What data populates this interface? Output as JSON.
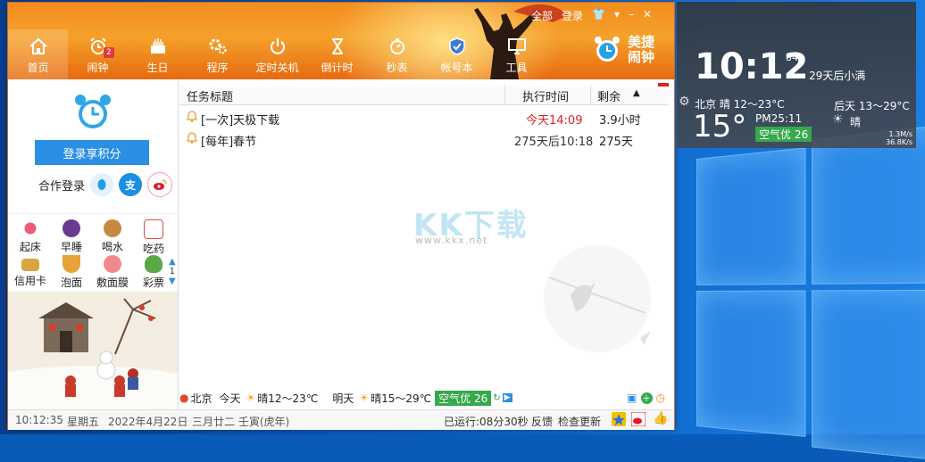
{
  "window_controls": {
    "all": "全部",
    "login": "登录"
  },
  "nav": [
    {
      "label": "首页",
      "icon": "home-icon",
      "active": true
    },
    {
      "label": "闹钟",
      "icon": "alarm-icon",
      "badge": "2"
    },
    {
      "label": "生日",
      "icon": "cake-icon"
    },
    {
      "label": "程序",
      "icon": "gears-icon"
    },
    {
      "label": "定时关机",
      "icon": "power-icon"
    },
    {
      "label": "倒计时",
      "icon": "hourglass-icon"
    },
    {
      "label": "秒表",
      "icon": "stopwatch-icon"
    },
    {
      "label": "帐号本",
      "icon": "shield-icon"
    },
    {
      "label": "工具",
      "icon": "monitor-icon"
    }
  ],
  "brand": {
    "line1": "美捷",
    "line2": "闹钟"
  },
  "sidebar": {
    "login_button": "登录享积分",
    "coop_label": "合作登录",
    "quick_items": [
      {
        "label": "起床",
        "color": "#f05a7a"
      },
      {
        "label": "早睡",
        "color": "#6a3a8f"
      },
      {
        "label": "喝水",
        "color": "#c58a3e"
      },
      {
        "label": "吃药",
        "color": "#e04848"
      },
      {
        "label": "信用卡",
        "color": "#d9a441"
      },
      {
        "label": "泡面",
        "color": "#e7a33a"
      },
      {
        "label": "敷面膜",
        "color": "#f08a8a"
      },
      {
        "label": "彩票",
        "color": "#5aa848"
      }
    ],
    "page_number": "1"
  },
  "task_table": {
    "columns": {
      "title": "任务标题",
      "time": "执行时间",
      "remaining": "剩余"
    },
    "rows": [
      {
        "title": "[一次]天极下载",
        "time": "今天14:09",
        "remaining": "3.9小时",
        "time_color": "#e02020"
      },
      {
        "title": "[每年]春节",
        "time": "275天后10:18",
        "remaining": "275天",
        "time_color": "#333333"
      }
    ]
  },
  "watermark": {
    "logo": "KK下载",
    "url": "www.kkx.net"
  },
  "weather_bar": {
    "city": "北京",
    "today_label": "今天",
    "today": "晴12～23℃",
    "tomorrow_label": "明天",
    "tomorrow": "晴15～29℃",
    "air": "空气优 26"
  },
  "status": {
    "clock": "10:12:35",
    "weekday": "星期五",
    "date": "2022年4月22日",
    "lunar": "三月廿二 壬寅(虎年)",
    "uptime": "已运行:08分30秒",
    "feedback": "反馈",
    "check_update": "检查更新"
  },
  "widget": {
    "time": "10:12",
    "seconds": "34",
    "lunar_note": "29天后小满",
    "city_line": "北京 晴 12～23°C",
    "day_after": "后天 13～29°C",
    "temp": "15°",
    "pm": "PM25:11",
    "condition": "晴",
    "air": "空气优 26",
    "net_up": "1.3M/s",
    "net_down": "36.8K/s"
  }
}
